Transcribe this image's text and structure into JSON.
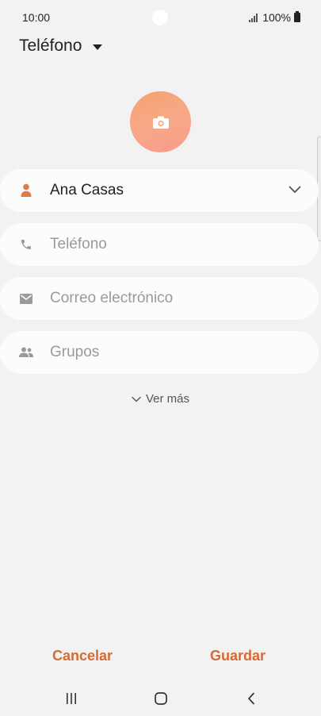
{
  "status_bar": {
    "time": "10:00",
    "battery": "100%"
  },
  "header": {
    "account_label": "Teléfono"
  },
  "fields": {
    "name": {
      "value": "Ana Casas"
    },
    "phone": {
      "placeholder": "Teléfono"
    },
    "email": {
      "placeholder": "Correo electrónico"
    },
    "groups": {
      "placeholder": "Grupos"
    }
  },
  "see_more": "Ver más",
  "actions": {
    "cancel": "Cancelar",
    "save": "Guardar"
  },
  "colors": {
    "accent": "#d76a33",
    "background": "#f2f2f2",
    "field_background": "#fcfcfc",
    "avatar_gradient_start": "#f6a070",
    "avatar_gradient_end": "#f99a8f"
  },
  "icons": {
    "person": "person-icon",
    "phone": "phone-icon",
    "email": "email-icon",
    "groups": "groups-icon",
    "camera": "camera-icon"
  }
}
